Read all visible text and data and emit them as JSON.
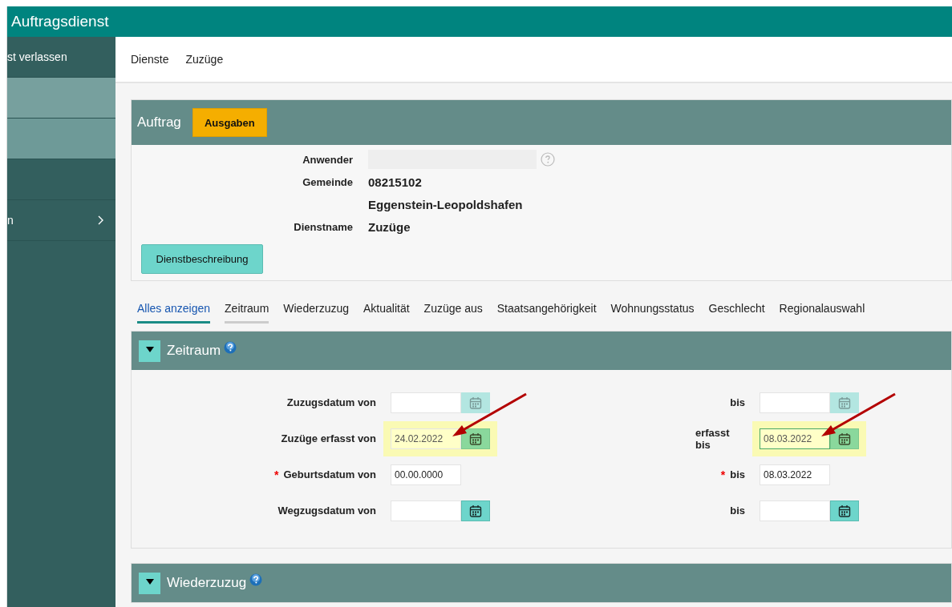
{
  "window": {
    "title": "Auftragsdienst"
  },
  "sidebar": {
    "items": [
      {
        "label": "st verlassen",
        "kind": "plain"
      },
      {
        "kind": "light"
      },
      {
        "kind": "mid"
      },
      {
        "kind": "plain"
      },
      {
        "label": "n",
        "kind": "submenu"
      }
    ]
  },
  "breadcrumb": [
    "Dienste",
    "Zuzüge"
  ],
  "order_panel": {
    "title": "Auftrag",
    "action": "Ausgaben",
    "rows": [
      {
        "label": "Anwender",
        "kind": "redacted"
      },
      {
        "label": "Gemeinde",
        "kind": "text",
        "value": "08215102"
      },
      {
        "kind": "text",
        "value": "Eggenstein-Leopoldshafen"
      },
      {
        "label": "Dienstname",
        "kind": "text",
        "value": "Zuzüge"
      }
    ],
    "button": "Dienstbeschreibung"
  },
  "tabs": [
    {
      "label": "Alles anzeigen",
      "selected": true,
      "hover": false
    },
    {
      "label": "Zeitraum",
      "selected": false,
      "hover": true
    },
    {
      "label": "Wiederzuzug",
      "selected": false,
      "hover": false
    },
    {
      "label": "Aktualität",
      "selected": false,
      "hover": false
    },
    {
      "label": "Zuzüge aus",
      "selected": false,
      "hover": false
    },
    {
      "label": "Staatsangehörigkeit",
      "selected": false,
      "hover": false
    },
    {
      "label": "Wohnungsstatus",
      "selected": false,
      "hover": false
    },
    {
      "label": "Geschlecht",
      "selected": false,
      "hover": false
    },
    {
      "label": "Regionalauswahl",
      "selected": false,
      "hover": false
    }
  ],
  "sections": [
    {
      "title": "Zeitraum",
      "expanded": true,
      "rows": [
        {
          "left": {
            "label": "Zuzugsdatum von",
            "kind": "date",
            "disabled": true,
            "highlighted": false,
            "focused": false
          },
          "right": {
            "label": "bis",
            "kind": "date",
            "disabled": true,
            "highlighted": false,
            "focused": false
          }
        },
        {
          "left": {
            "label": "Zuzüge erfasst von",
            "kind": "date",
            "value": "24.02.2022",
            "disabled": false,
            "highlighted": true,
            "focused": false
          },
          "right": {
            "label": "erfasst bis",
            "kind": "date",
            "value": "08.03.2022",
            "disabled": false,
            "highlighted": true,
            "focused": true
          }
        },
        {
          "left": {
            "marker": "*",
            "label": "Geburtsdatum von",
            "kind": "text",
            "value": "00.00.0000",
            "highlighted": false,
            "focused": false
          },
          "right": {
            "marker": "*",
            "label": "bis",
            "kind": "text",
            "value": "08.03.2022",
            "highlighted": false,
            "focused": false
          }
        },
        {
          "left": {
            "label": "Wegzugsdatum von",
            "kind": "date",
            "disabled": false,
            "highlighted": false,
            "focused": false
          },
          "right": {
            "label": "bis",
            "kind": "date",
            "disabled": false,
            "highlighted": false,
            "focused": false
          }
        }
      ]
    },
    {
      "title": "Wiederzuzug",
      "expanded": true
    }
  ]
}
